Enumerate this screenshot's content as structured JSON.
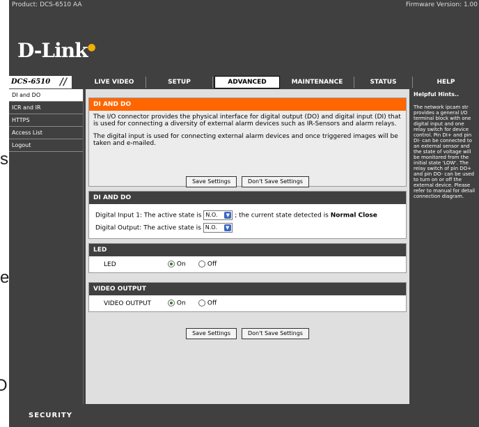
{
  "background": {
    "left_fragments": [
      "s",
      "e",
      "O"
    ]
  },
  "topbar": {
    "product": "Product: DCS-6510 AA",
    "firmware": "Firmware Version: 1.00"
  },
  "logo": {
    "text": "D-Link"
  },
  "nav": {
    "model": "DCS-6510",
    "tabs": [
      "LIVE VIDEO",
      "SETUP",
      "ADVANCED",
      "MAINTENANCE",
      "STATUS",
      "HELP"
    ],
    "active_tab": "ADVANCED"
  },
  "sidebar": {
    "items": [
      "DI and DO",
      "ICR and IR",
      "HTTPS",
      "Access List",
      "Logout"
    ],
    "active": "DI and DO"
  },
  "intro": {
    "title": "DI AND DO",
    "para1": "The I/O connector provides the physical interface for digital output (DO) and digital input (DI) that is used for connecting a diversity of external alarm devices such as IR-Sensors and alarm relays.",
    "para2": "The digital input is used for connecting external alarm devices and once triggered images will be taken and e-mailed.",
    "save_label": "Save Settings",
    "dont_save_label": "Don't Save Settings"
  },
  "dido": {
    "title": "DI AND DO",
    "input_label": "Digital Input 1: The active state is",
    "input_value": "N.O.",
    "input_state_text": "; the current state detected is",
    "input_state_value": "Normal Close",
    "output_label": "Digital Output: The active state is",
    "output_value": "N.O."
  },
  "led": {
    "title": "LED",
    "label": "LED",
    "on_label": "On",
    "off_label": "Off",
    "selected": "On"
  },
  "video_output": {
    "title": "VIDEO OUTPUT",
    "label": "VIDEO OUTPUT",
    "on_label": "On",
    "off_label": "Off",
    "selected": "On"
  },
  "bottom": {
    "save_label": "Save Settings",
    "dont_save_label": "Don't Save Settings"
  },
  "hints": {
    "title": "Helpful Hints..",
    "body": "The network ipcam str provides a general I/O terminal block with one digital input and one relay switch for device control. Pin DI+ and pin DI- can be connected to an external sensor and the state of voltage will be monitored from the initial state 'LOW'. The relay switch of pin DO+ and pin DO- can be used to turn on or off the external device. Please refer to manual for detail connection diagram."
  },
  "footer": {
    "text": "SECURITY"
  },
  "colors": {
    "dark": "#404040",
    "accent": "#ff6600",
    "panel": "#dfdfdf"
  }
}
